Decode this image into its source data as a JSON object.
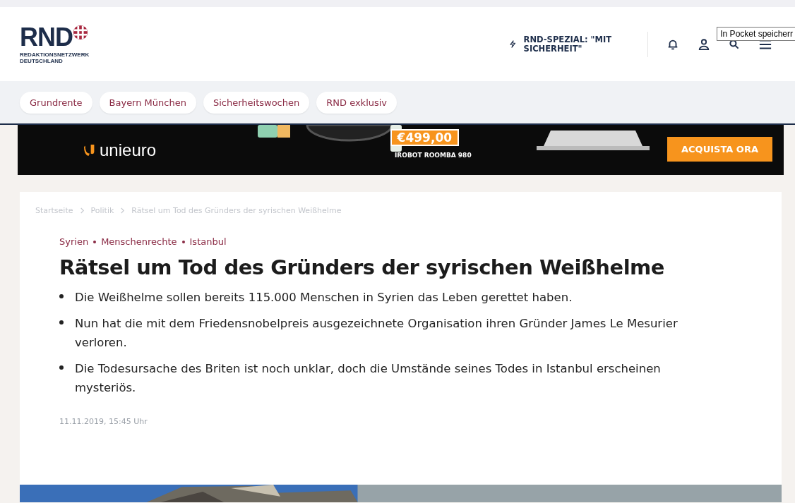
{
  "header": {
    "logo": "RND",
    "logo_subtitle": "REDAKTIONSNETZWERK DEUTSCHLAND",
    "special": "RND-SPEZIAL: \"MIT SICHERHEIT\"",
    "tooltip": "In Pocket speicherr"
  },
  "topics": [
    {
      "label": "Grundrente"
    },
    {
      "label": "Bayern München"
    },
    {
      "label": "Sicherheitswochen"
    },
    {
      "label": "RND exklusiv"
    }
  ],
  "ad": {
    "brand": "unieuro",
    "price": "€499,00",
    "product": "IROBOT ROOMBA 980",
    "cta": "ACQUISTA ORA"
  },
  "breadcrumb": [
    {
      "label": "Startseite"
    },
    {
      "label": "Politik"
    },
    {
      "label": "Rätsel um Tod des Gründers der syrischen Weißhelme"
    }
  ],
  "tags": [
    {
      "label": "Syrien"
    },
    {
      "label": "Menschenrechte"
    },
    {
      "label": "Istanbul"
    }
  ],
  "headline": "Rätsel um Tod des Gründers der syrischen Weißhelme",
  "bullets": [
    "Die Weißhelme sollen bereits 115.000 Menschen in Syrien das Leben gerettet haben.",
    "Nun hat die mit dem Friedensnobelpreis ausgezeichnete Organisation ihren Gründer James Le Mesurier verloren.",
    "Die Todesursache des Briten ist noch unklar, doch die Umstände seines Todes in Istanbul erscheinen mysteriös."
  ],
  "date": "11.11.2019, 15:45 Uhr",
  "hero": {
    "kind": "picture"
  }
}
